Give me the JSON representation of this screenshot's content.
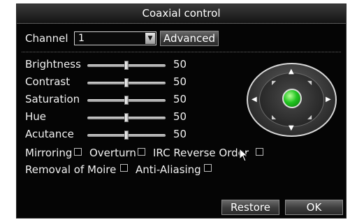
{
  "window": {
    "title": "Coaxial control"
  },
  "channel": {
    "label": "Channel",
    "value": "1",
    "advanced_label": "Advanced"
  },
  "sliders": [
    {
      "label": "Brightness",
      "value": "50",
      "level": 0.5
    },
    {
      "label": "Contrast",
      "value": "50",
      "level": 0.5
    },
    {
      "label": "Saturation",
      "value": "50",
      "level": 0.5
    },
    {
      "label": "Hue",
      "value": "50",
      "level": 0.5
    },
    {
      "label": "Acutance",
      "value": "50",
      "level": 0.5
    }
  ],
  "checkboxes": {
    "mirroring": {
      "label": "Mirroring",
      "checked": false
    },
    "overturn": {
      "label": "Overturn",
      "checked": false
    },
    "irc_reverse_order": {
      "label": "IRC Reverse Order",
      "checked": false
    },
    "removal_of_moire": {
      "label": "Removal of Moire",
      "checked": false
    },
    "anti_aliasing": {
      "label": "Anti-Aliasing",
      "checked": false
    }
  },
  "ptz": {
    "icons": [
      "up-arrow-icon",
      "down-arrow-icon",
      "left-arrow-icon",
      "right-arrow-icon",
      "center-button-icon"
    ],
    "center_color": "#21c421"
  },
  "footer": {
    "restore_label": "Restore",
    "ok_label": "OK"
  }
}
